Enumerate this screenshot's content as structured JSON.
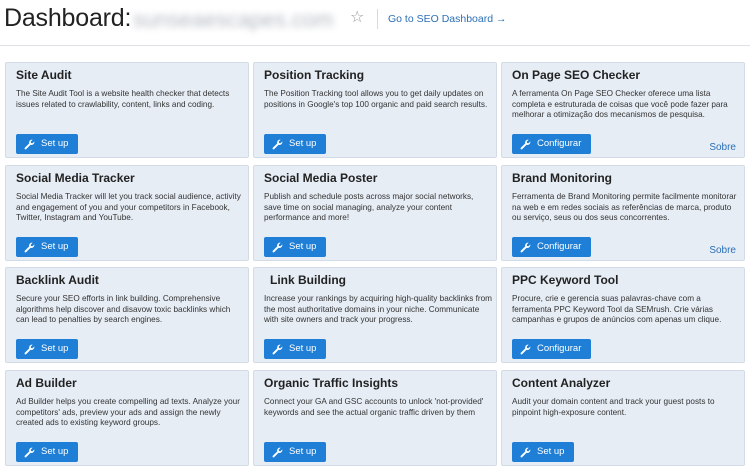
{
  "header": {
    "title": "Dashboard:",
    "domain": "sunseaescapes.com",
    "seo_link": "Go to SEO Dashboard →"
  },
  "cards": [
    {
      "title": "Site Audit",
      "desc": "The Site Audit Tool is a website health checker that detects issues related to crawlability, content, links and coding.",
      "button": "Set up"
    },
    {
      "title": "Position Tracking",
      "desc": "The Position Tracking tool allows you to get daily updates on positions in Google's top 100 organic and paid search results.",
      "button": "Set up"
    },
    {
      "title": "On Page SEO Checker",
      "desc": "A ferramenta On Page SEO Checker oferece uma lista completa e estruturada de coisas que você pode fazer para melhorar a otimização dos mecanismos de pesquisa.",
      "button": "Configurar",
      "more": "Sobre"
    },
    {
      "title": "Social Media Tracker",
      "desc": "Social Media Tracker will let you track social audience, activity and engagement of you and your competitors in Facebook, Twitter, Instagram and YouTube.",
      "button": "Set up"
    },
    {
      "title": "Social Media Poster",
      "desc": "Publish and schedule posts across major social networks, save time on social managing, analyze your content performance and more!",
      "button": "Set up"
    },
    {
      "title": "Brand Monitoring",
      "desc": "Ferramenta de Brand Monitoring permite facilmente monitorar na web e em redes sociais as referências de marca, produto ou serviço, seus ou dos seus concorrentes.",
      "button": "Configurar",
      "more": "Sobre"
    },
    {
      "title": "Backlink Audit",
      "desc": "Secure your SEO efforts in link building. Comprehensive algorithms help discover and disavow toxic backlinks which can lead to penalties by search engines.",
      "button": "Set up"
    },
    {
      "title": "Link Building",
      "desc": "Increase your rankings by acquiring high-quality backlinks from the most authoritative domains in your niche. Communicate with site owners and track your progress.",
      "button": "Set up"
    },
    {
      "title": "PPC Keyword Tool",
      "desc": "Procure, crie e gerencia suas palavras-chave com a ferramenta PPC Keyword Tool da SEMrush. Crie várias campanhas e grupos de anúncios com apenas um clique.",
      "button": "Configurar"
    },
    {
      "title": "Ad Builder",
      "desc": "Ad Builder helps you create compelling ad texts. Analyze your competitors' ads, preview your ads and assign the newly created ads to existing keyword groups.",
      "button": "Set up"
    },
    {
      "title": "Organic Traffic Insights",
      "desc": "Connect your GA and GSC accounts to unlock 'not-provided' keywords and see the actual organic traffic driven by them",
      "button": "Set up"
    },
    {
      "title": "Content Analyzer",
      "desc": "Audit your domain content and track your guest posts to pinpoint high-exposure content.",
      "button": "Set up"
    }
  ],
  "colors": {
    "card_bg": "#e6edf5",
    "button": "#1f7fd6",
    "link": "#2b6fb6"
  },
  "icons": {
    "star": "star-icon",
    "button": "wrench-icon"
  }
}
